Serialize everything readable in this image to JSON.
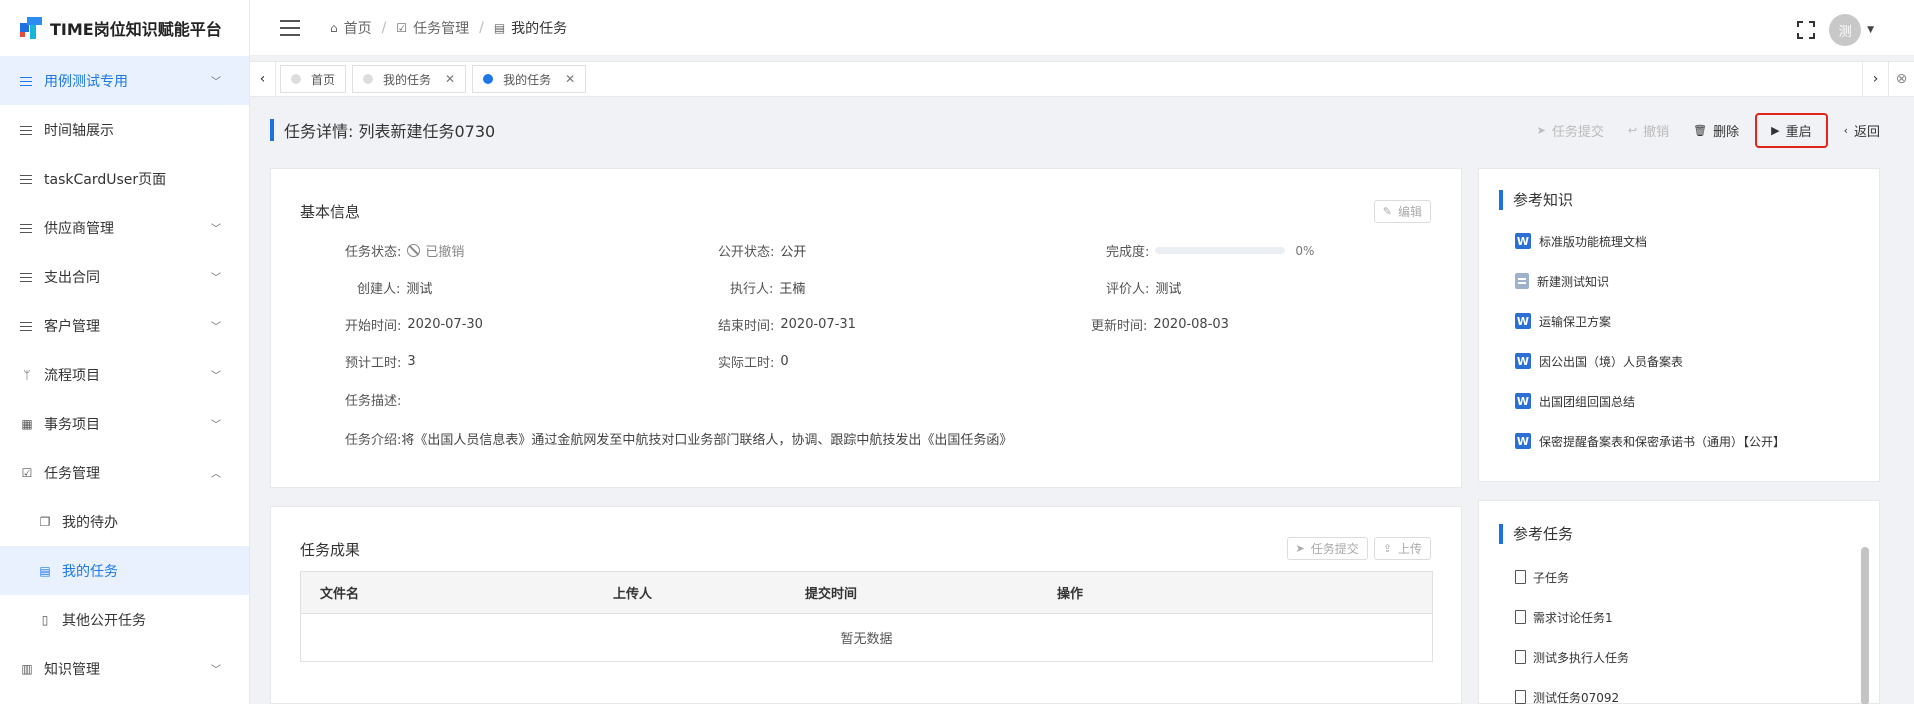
{
  "app": {
    "title": "TIME岗位知识赋能平台"
  },
  "sidebar": {
    "items": [
      {
        "label": "用例测试专用",
        "icon": "list-icon",
        "chevron": "down",
        "active": true
      },
      {
        "label": "时间轴展示",
        "icon": "list-icon"
      },
      {
        "label": "taskCardUser页面",
        "icon": "list-icon"
      },
      {
        "label": "供应商管理",
        "icon": "list-icon",
        "chevron": "down"
      },
      {
        "label": "支出合同",
        "icon": "list-icon",
        "chevron": "down"
      },
      {
        "label": "客户管理",
        "icon": "list-icon",
        "chevron": "down"
      },
      {
        "label": "流程项目",
        "icon": "branch-icon",
        "chevron": "down"
      },
      {
        "label": "事务项目",
        "icon": "grid-icon",
        "chevron": "down"
      },
      {
        "label": "任务管理",
        "icon": "calendar-check-icon",
        "chevron": "up"
      },
      {
        "label": "我的待办",
        "icon": "copy-icon",
        "sub": true
      },
      {
        "label": "我的任务",
        "icon": "document-icon",
        "sub": true,
        "active": true
      },
      {
        "label": "其他公开任务",
        "icon": "file-icon",
        "sub": true
      },
      {
        "label": "知识管理",
        "icon": "book-icon",
        "chevron": "down"
      }
    ]
  },
  "header": {
    "breadcrumb": [
      {
        "label": "首页",
        "icon": "home-icon"
      },
      {
        "label": "任务管理",
        "icon": "calendar-check-icon"
      },
      {
        "label": "我的任务",
        "icon": "document-icon"
      }
    ],
    "avatar_text": "测"
  },
  "tabs": [
    {
      "label": "首页",
      "closable": false,
      "active": false
    },
    {
      "label": "我的任务",
      "closable": true,
      "active": false
    },
    {
      "label": "我的任务",
      "closable": true,
      "active": true
    }
  ],
  "page": {
    "title": "任务详情: 列表新建任务0730",
    "actions": {
      "submit": "任务提交",
      "revoke": "撤销",
      "delete": "删除",
      "restart": "重启",
      "back": "返回"
    }
  },
  "basic_info": {
    "title": "基本信息",
    "edit": "编辑",
    "fields": {
      "status_label": "任务状态:",
      "status_value": "已撤销",
      "public_label": "公开状态:",
      "public_value": "公开",
      "progress_label": "完成度:",
      "progress_value": 0,
      "progress_text": "0%",
      "creator_label": "创建人:",
      "creator_value": "测试",
      "executor_label": "执行人:",
      "executor_value": "王楠",
      "evaluator_label": "评价人:",
      "evaluator_value": "测试",
      "start_label": "开始时间:",
      "start_value": "2020-07-30",
      "end_label": "结束时间:",
      "end_value": "2020-07-31",
      "update_label": "更新时间:",
      "update_value": "2020-08-03",
      "est_hours_label": "预计工时:",
      "est_hours_value": "3",
      "act_hours_label": "实际工时:",
      "act_hours_value": "0",
      "desc_label": "任务描述:",
      "desc_value": "",
      "intro_label": "任务介绍:",
      "intro_value": "将《出国人员信息表》通过金航网发至中航技对口业务部门联络人，协调、跟踪中航技发出《出国任务函》"
    }
  },
  "results": {
    "title": "任务成果",
    "submit": "任务提交",
    "upload": "上传",
    "columns": [
      "文件名",
      "上传人",
      "提交时间",
      "操作"
    ],
    "empty": "暂无数据"
  },
  "reference_knowledge": {
    "title": "参考知识",
    "items": [
      {
        "label": "标准版功能梳理文档",
        "icon": "word-icon"
      },
      {
        "label": "新建测试知识",
        "icon": "doc-icon"
      },
      {
        "label": "运输保卫方案",
        "icon": "word-icon"
      },
      {
        "label": "因公出国（境）人员备案表",
        "icon": "word-icon"
      },
      {
        "label": "出国团组回国总结",
        "icon": "word-icon"
      },
      {
        "label": "保密提醒备案表和保密承诺书（通用）【公开】",
        "icon": "word-icon"
      }
    ]
  },
  "reference_tasks": {
    "title": "参考任务",
    "items": [
      "子任务",
      "需求讨论任务1",
      "测试多执行人任务",
      "测试任务07092"
    ]
  },
  "colors": {
    "primary": "#1e78e6",
    "highlight_border": "#e0261c"
  }
}
